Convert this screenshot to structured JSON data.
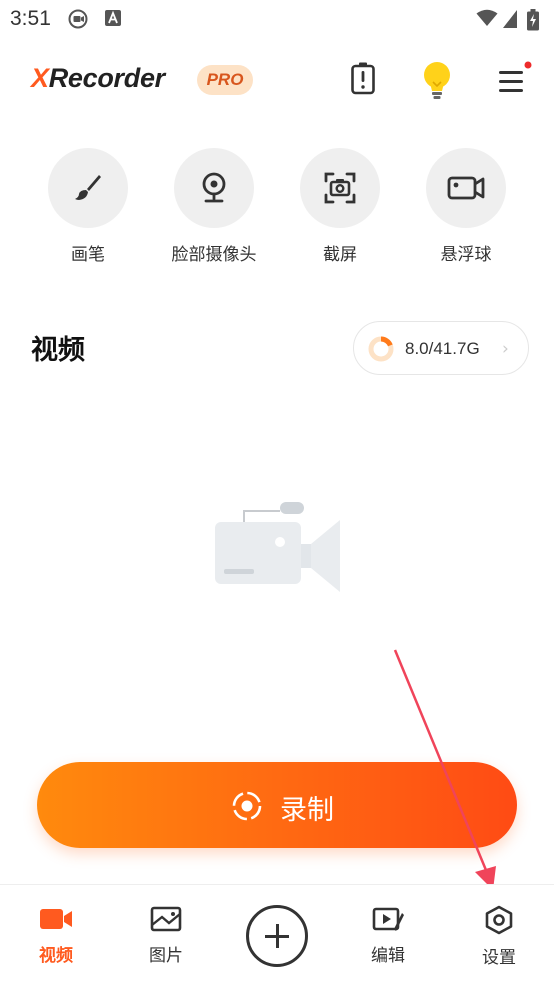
{
  "status_bar": {
    "time": "3:51"
  },
  "header": {
    "app_name_prefix": "X",
    "app_name_rest": "Recorder",
    "pro_badge": "PRO"
  },
  "tools": [
    {
      "label": "画笔",
      "icon": "brush-icon"
    },
    {
      "label": "脸部摄像头",
      "icon": "webcam-icon"
    },
    {
      "label": "截屏",
      "icon": "screenshot-icon"
    },
    {
      "label": "悬浮球",
      "icon": "floating-ball-icon"
    }
  ],
  "video_section": {
    "title": "视频",
    "storage": "8.0/41.7G",
    "storage_used_fraction": 0.19
  },
  "record_button": {
    "label": "录制"
  },
  "bottom_nav": {
    "items": [
      {
        "label": "视频",
        "icon": "video-icon",
        "active": true
      },
      {
        "label": "图片",
        "icon": "image-icon",
        "active": false
      },
      {
        "label": "编辑",
        "icon": "edit-video-icon",
        "active": false
      },
      {
        "label": "设置",
        "icon": "settings-icon",
        "active": false
      }
    ]
  },
  "colors": {
    "accent": "#ff5a1f",
    "record_gradient_start": "#ff8a0d",
    "record_gradient_end": "#ff4b14",
    "annotation_arrow": "#f0445a"
  }
}
